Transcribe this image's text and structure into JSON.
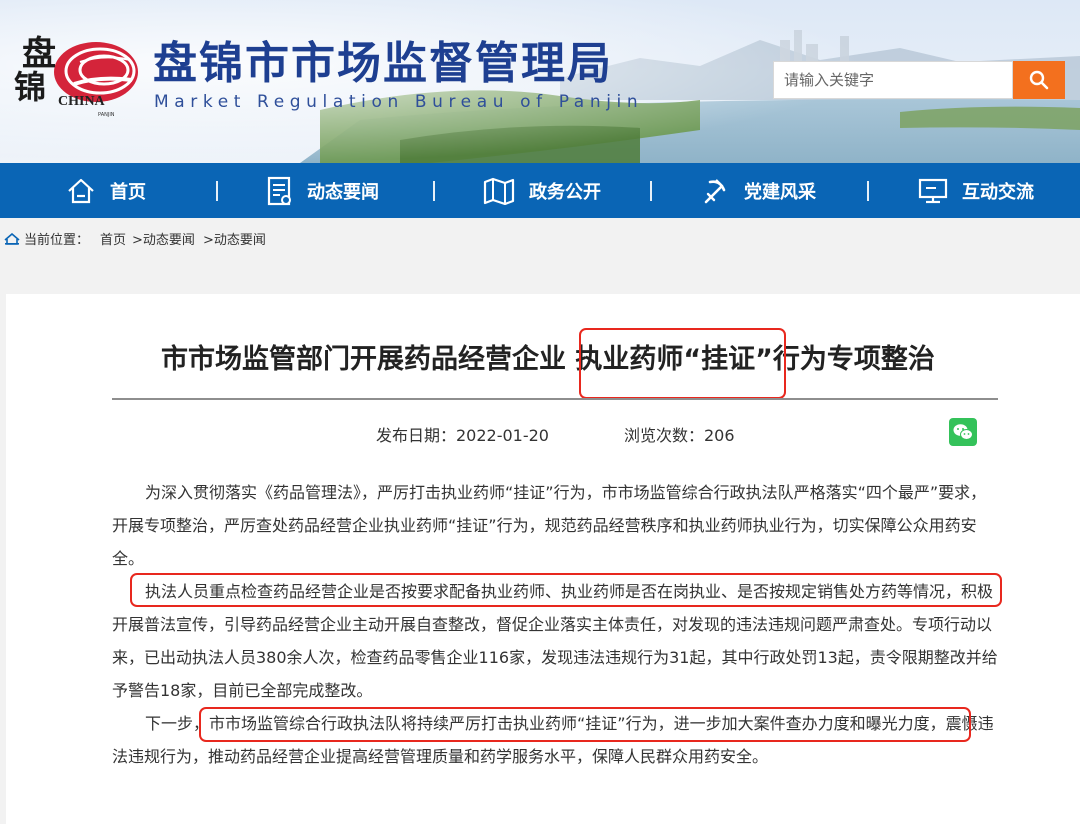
{
  "header": {
    "logo_chars": [
      "盘",
      "锦"
    ],
    "logo_china": "CHINA",
    "logo_sub": "PANJIN",
    "title": "盘锦市市场监督管理局",
    "subtitle": "Market Regulation Bureau of Panjin",
    "search_placeholder": "请输入关键字",
    "accent_color": "#f3701e",
    "title_color": "#1e3f91"
  },
  "nav": {
    "bg_color": "#0a65b5",
    "items": [
      {
        "label": "首页",
        "icon": "home-icon"
      },
      {
        "label": "动态要闻",
        "icon": "news-icon"
      },
      {
        "label": "政务公开",
        "icon": "map-icon"
      },
      {
        "label": "党建风采",
        "icon": "party-icon"
      },
      {
        "label": "互动交流",
        "icon": "monitor-icon"
      }
    ]
  },
  "breadcrumb": {
    "label": "当前位置：",
    "items": [
      "首页",
      ">动态要闻",
      ">动态要闻"
    ]
  },
  "article": {
    "title": "市市场监管部门开展药品经营企业 执业药师“挂证”行为专项整治",
    "publish_date": "发布日期：2022-01-20",
    "views": "浏览次数：206",
    "share_icon": "wechat-icon",
    "paragraphs": [
      "为深入贯彻落实《药品管理法》，严厉打击执业药师“挂证”行为，市市场监管综合行政执法队严格落实“四个最严”要求，开展专项整治，严厉查处药品经营企业执业药师“挂证”行为，规范药品经营秩序和执业药师执业行为，切实保障公众用药安全。",
      "执法人员重点检查药品经营企业是否按要求配备执业药师、执业药师是否在岗执业、是否按规定销售处方药等情况，积极开展普法宣传，引导药品经营企业主动开展自查整改，督促企业落实主体责任，对发现的违法违规问题严肃查处。专项行动以来，已出动执法人员380余人次，检查药品零售企业116家，发现违法违规行为31起，其中行政处罚13起，责令限期整改并给予警告18家，目前已全部完成整改。",
      "下一步，市市场监管综合行政执法队将持续严厉打击执业药师“挂证”行为，进一步加大案件查办力度和曝光力度，震慑违法违规行为，推动药品经营企业提高经营管理质量和药学服务水平，保障人民群众用药安全。"
    ],
    "highlight_color": "#e8281e"
  }
}
